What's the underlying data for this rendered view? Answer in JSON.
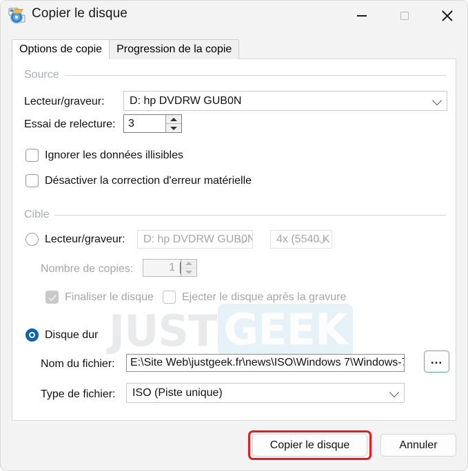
{
  "window": {
    "title": "Copier le disque",
    "icon": "disc-copy-icon",
    "controls": {
      "minimize": "minimize-icon",
      "maximize": "maximize-icon",
      "close": "close-icon"
    }
  },
  "tabs": [
    {
      "label": "Options de copie",
      "active": true
    },
    {
      "label": "Progression de la copie",
      "active": false
    }
  ],
  "watermark": {
    "part1": "JUST",
    "part2": "GEEK"
  },
  "source": {
    "group_label": "Source",
    "drive_label": "Lecteur/graveur:",
    "drive_value": "D: hp DVDRW  GUB0N",
    "retry_label": "Essai de relecture:",
    "retry_value": "3",
    "checkbox_ignore": {
      "label": "Ignorer les données illisibles",
      "checked": false
    },
    "checkbox_disable_ecc": {
      "label": "Désactiver la correction d'erreur matérielle",
      "checked": false
    }
  },
  "target": {
    "group_label": "Cible",
    "radio_drive_label": "Lecteur/graveur:",
    "radio_drive_selected": false,
    "drive_value": "D: hp DVDRW  GUB0N",
    "speed_value": "4x (5540 K",
    "copies_label": "Nombre de copies:",
    "copies_value": "1",
    "checkbox_finalize": {
      "label": "Finaliser le disque",
      "checked": true,
      "disabled": true
    },
    "checkbox_eject": {
      "label": "Ejecter le disque après la gravure",
      "checked": false,
      "disabled": true
    },
    "radio_harddisk_label": "Disque dur",
    "radio_harddisk_selected": true,
    "filename_label": "Nom du fichier:",
    "filename_value": "E:\\Site Web\\justgeek.fr\\news\\ISO\\Windows 7\\Windows-7",
    "browse_label": "...",
    "filetype_label": "Type de fichier:",
    "filetype_value": "ISO (Piste unique)"
  },
  "footer": {
    "primary_label": "Copier le disque",
    "secondary_label": "Annuler",
    "highlight_color": "#e81b1b"
  }
}
